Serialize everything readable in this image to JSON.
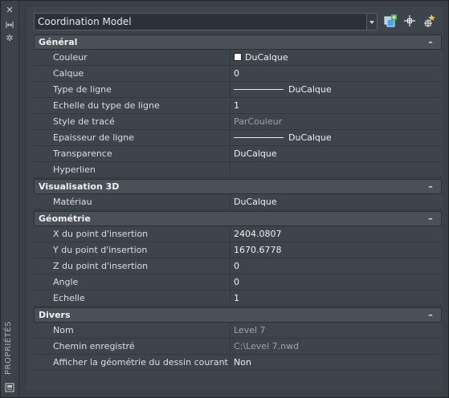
{
  "palette": {
    "side_title": "PROPRIÉTÉS"
  },
  "header": {
    "object_type": "Coordination Model"
  },
  "icons": {
    "close": "close-icon",
    "autohide": "autohide-icon",
    "settings": "gear-icon",
    "toggle_pickadd": "toggle-pickadd-icon",
    "select_objects": "select-objects-icon",
    "quick_select": "quick-select-icon",
    "panel_properties": "properties-panel-icon"
  },
  "categories": [
    {
      "title": "Général",
      "toggle": "–",
      "rows": [
        {
          "name": "Couleur",
          "value": "DuCalque"
        },
        {
          "name": "Calque",
          "value": "0"
        },
        {
          "name": "Type de ligne",
          "value": "DuCalque"
        },
        {
          "name": "Echelle du type de ligne",
          "value": "1"
        },
        {
          "name": "Style de tracé",
          "value": "ParCouleur"
        },
        {
          "name": "Epaisseur de ligne",
          "value": "DuCalque"
        },
        {
          "name": "Transparence",
          "value": "DuCalque"
        },
        {
          "name": "Hyperlien",
          "value": ""
        }
      ]
    },
    {
      "title": "Visualisation 3D",
      "toggle": "–",
      "rows": [
        {
          "name": "Matériau",
          "value": "DuCalque"
        }
      ]
    },
    {
      "title": "Géométrie",
      "toggle": "–",
      "rows": [
        {
          "name": "X du point d'insertion",
          "value": "2404.0807"
        },
        {
          "name": "Y du point d'insertion",
          "value": "1670.6778"
        },
        {
          "name": "Z du point d'insertion",
          "value": "0"
        },
        {
          "name": "Angle",
          "value": "0"
        },
        {
          "name": "Echelle",
          "value": "1"
        }
      ]
    },
    {
      "title": "Divers",
      "toggle": "–",
      "rows": [
        {
          "name": "Nom",
          "value": "Level 7"
        },
        {
          "name": "Chemin enregistré",
          "value": "C:\\Level 7.nwd"
        },
        {
          "name": "Afficher la géométrie du dessin courant",
          "value": "Non"
        }
      ]
    }
  ]
}
